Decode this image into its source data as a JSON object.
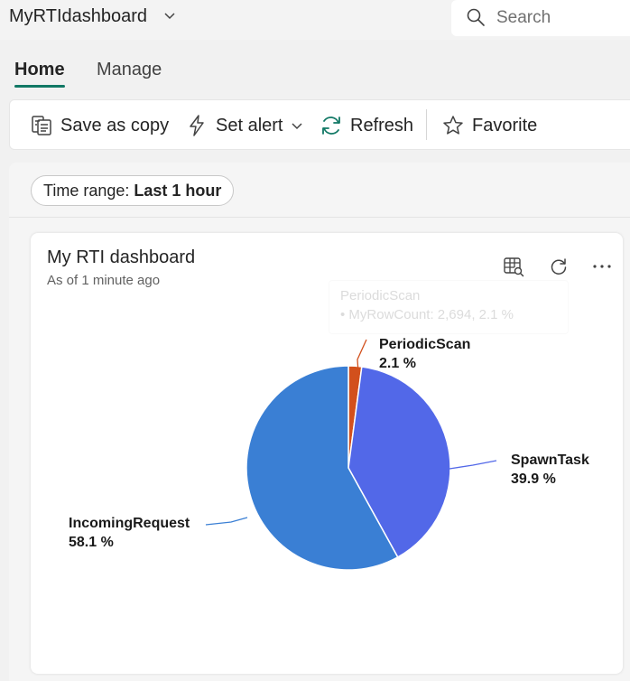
{
  "header": {
    "app_title": "MyRTIdashboard",
    "search_placeholder": "Search"
  },
  "tabs": [
    {
      "label": "Home",
      "active": true
    },
    {
      "label": "Manage",
      "active": false
    }
  ],
  "toolbar": {
    "save_as_copy": "Save as copy",
    "set_alert": "Set alert",
    "refresh": "Refresh",
    "favorite": "Favorite"
  },
  "time_range": {
    "label": "Time range:",
    "value": "Last 1 hour"
  },
  "tile": {
    "title": "My RTI dashboard",
    "subtitle": "As of 1 minute ago",
    "tooltip_line1": "PeriodicScan",
    "tooltip_line2": "• MyRowCount: 2,694, 2.1 %"
  },
  "colors": {
    "accent": "#117865",
    "PeriodicScan": "#d2501c",
    "SpawnTask": "#5268e8",
    "IncomingRequest": "#3a7fd4"
  },
  "chart_data": {
    "type": "pie",
    "categories": [
      "PeriodicScan",
      "SpawnTask",
      "IncomingRequest"
    ],
    "values": [
      2.1,
      39.9,
      58.1
    ],
    "value_labels": [
      "2.1 %",
      "39.9 %",
      "58.1 %"
    ],
    "title": "",
    "legend": "none"
  }
}
